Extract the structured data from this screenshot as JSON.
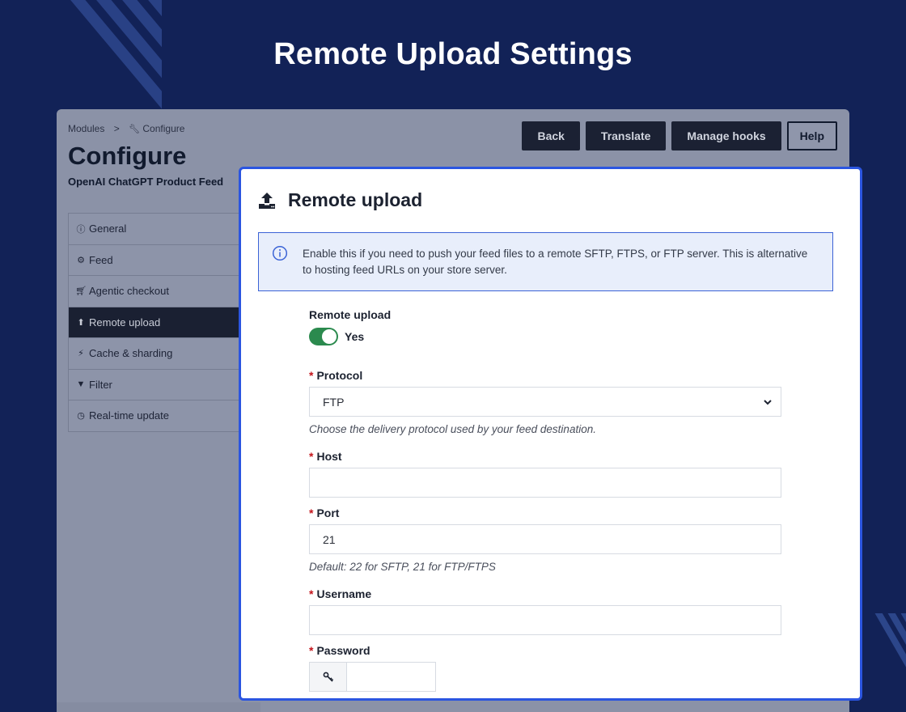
{
  "page": {
    "title": "Remote Upload Settings"
  },
  "admin": {
    "breadcrumb": {
      "parent": "Modules",
      "separator": ">",
      "current": "Configure",
      "current_icon": "wrench-icon"
    },
    "title": "Configure",
    "subtitle": "OpenAI ChatGPT Product Feed",
    "toolbar": {
      "back": "Back",
      "translate": "Translate",
      "manage_hooks": "Manage hooks",
      "help": "Help"
    },
    "nav": [
      {
        "label": "General",
        "icon": "info-circle-icon",
        "active": false
      },
      {
        "label": "Feed",
        "icon": "gears-icon",
        "active": false
      },
      {
        "label": "Agentic checkout",
        "icon": "cart-icon",
        "active": false
      },
      {
        "label": "Remote upload",
        "icon": "upload-icon",
        "active": true
      },
      {
        "label": "Cache & sharding",
        "icon": "bolt-icon",
        "active": false
      },
      {
        "label": "Filter",
        "icon": "filter-icon",
        "active": false
      },
      {
        "label": "Real-time update",
        "icon": "clock-icon",
        "active": false
      }
    ]
  },
  "modal": {
    "title": "Remote upload",
    "icon": "upload-icon",
    "info": "Enable this if you need to push your feed files to a remote SFTP, FTPS, or FTP server. This is alternative to hosting feed URLs on your store server.",
    "remote_upload": {
      "label": "Remote upload",
      "value": "Yes",
      "enabled": true
    },
    "protocol": {
      "required": "*",
      "label": "Protocol",
      "value": "FTP",
      "help": "Choose the delivery protocol used by your feed destination."
    },
    "host": {
      "required": "*",
      "label": "Host",
      "value": ""
    },
    "port": {
      "required": "*",
      "label": "Port",
      "value": "21",
      "help": "Default: 22 for SFTP, 21 for FTP/FTPS"
    },
    "username": {
      "required": "*",
      "label": "Username",
      "value": ""
    },
    "password": {
      "required": "*",
      "label": "Password",
      "value": "",
      "icon": "key-icon"
    }
  },
  "colors": {
    "background": "#122257",
    "modal_border": "#2b55e0",
    "toggle_on": "#2b8a4e",
    "required": "#c4141b"
  }
}
